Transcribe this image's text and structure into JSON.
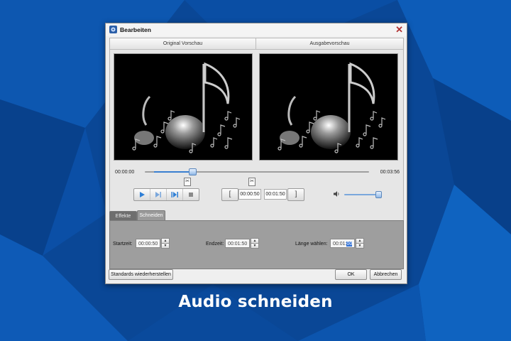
{
  "caption": "Audio schneiden",
  "dialog": {
    "title": "Bearbeiten",
    "close_glyph": "✕",
    "original_label": "Original Vorschau",
    "output_label": "Ausgabevorschau"
  },
  "timeline": {
    "start_time": "00:00:00",
    "end_time": "00:03:56",
    "marker_glyph": "✂",
    "position_fraction": 0.21
  },
  "controls": {
    "cut_start": "00:00:50",
    "cut_end": "00:01:50",
    "bracket_open": "[",
    "bracket_close": "]",
    "volume_fraction": 0.9
  },
  "tabs": [
    {
      "label": "Effekte",
      "active": false
    },
    {
      "label": "Schneiden",
      "active": true
    }
  ],
  "cut": {
    "start_label": "Startzeit:",
    "start_value": "00:00:50",
    "end_label": "Endzeit:",
    "end_value": "00:01:50",
    "length_label": "Länge wählen:",
    "length_prefix": "00:01:",
    "length_selected": "00",
    "spin_up": "▲",
    "spin_down": "▼"
  },
  "buttons": {
    "restore": "Standards wiederherstellen",
    "ok": "OK",
    "cancel": "Abbrechen"
  },
  "colors": {
    "background": "#0b4a9a",
    "accent": "#3a7fd0",
    "close": "#b03030"
  }
}
